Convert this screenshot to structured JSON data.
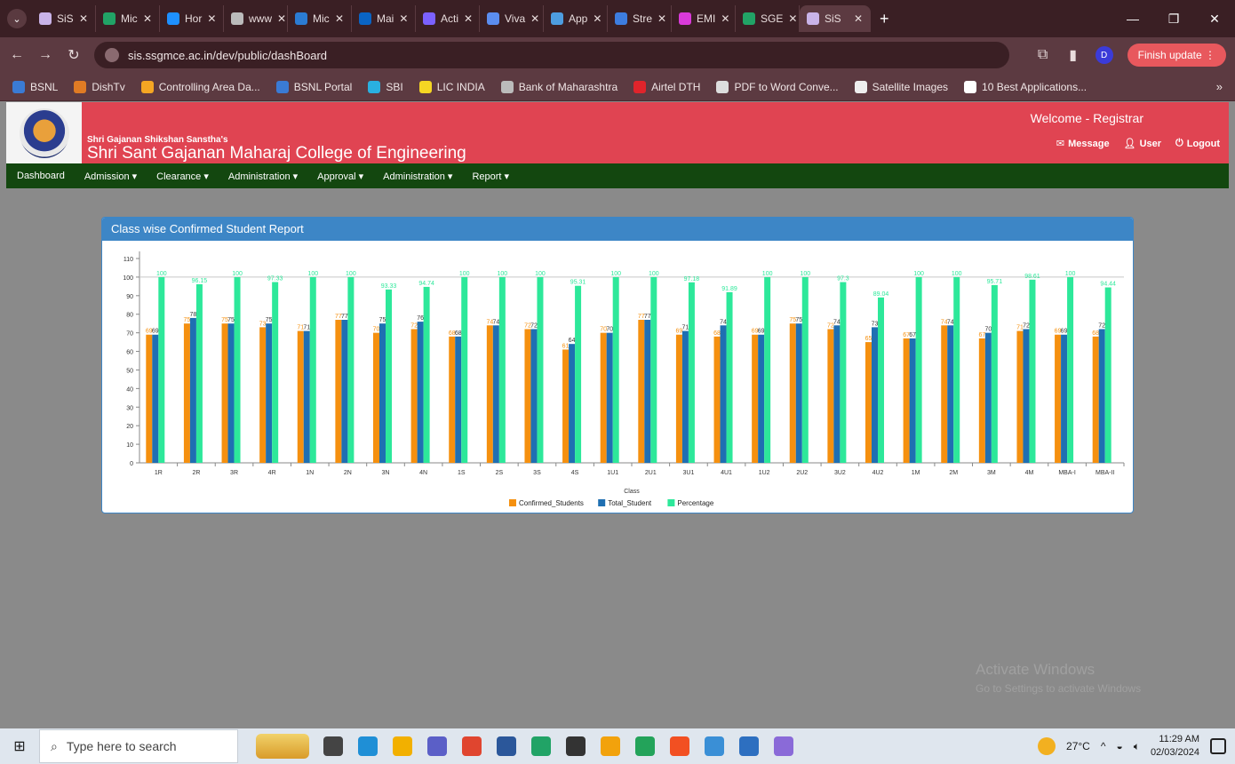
{
  "browser": {
    "tabs": [
      {
        "label": "SiS",
        "color": "#c9b3e8"
      },
      {
        "label": "Mic",
        "color": "#21a366"
      },
      {
        "label": "Hor",
        "color": "#1e90ff"
      },
      {
        "label": "www",
        "color": "#bbbbbb"
      },
      {
        "label": "Mic",
        "color": "#2b7cd3"
      },
      {
        "label": "Mai",
        "color": "#0a64c4"
      },
      {
        "label": "Acti",
        "color": "#7b61ff"
      },
      {
        "label": "Viva",
        "color": "#5b8def"
      },
      {
        "label": "App",
        "color": "#4d9de0"
      },
      {
        "label": "Stre",
        "color": "#3d7de0"
      },
      {
        "label": "EMI",
        "color": "#d93ad9"
      },
      {
        "label": "SGE",
        "color": "#21a366"
      },
      {
        "label": "SiS",
        "color": "#c9b3e8",
        "active": true
      }
    ],
    "url": "sis.ssgmce.ac.in/dev/public/dashBoard",
    "profile_initial": "D",
    "finish_update": "Finish update",
    "bookmarks": [
      {
        "label": "BSNL",
        "color": "#3a7bd5"
      },
      {
        "label": "DishTv",
        "color": "#e07b24"
      },
      {
        "label": "Controlling Area Da...",
        "color": "#f5a623"
      },
      {
        "label": "BSNL Portal",
        "color": "#3a7bd5"
      },
      {
        "label": "SBI",
        "color": "#2ab0e0"
      },
      {
        "label": "LIC INDIA",
        "color": "#f5d623"
      },
      {
        "label": "Bank of Maharashtra",
        "color": "#bbbbbb"
      },
      {
        "label": "Airtel DTH",
        "color": "#e0242b"
      },
      {
        "label": "PDF to Word Conve...",
        "color": "#dddddd"
      },
      {
        "label": "Satellite Images",
        "color": "#eeeeee"
      },
      {
        "label": "10 Best Applications...",
        "color": "#ffffff"
      }
    ]
  },
  "site": {
    "sanstha": "Shri Gajanan Shikshan Sanstha's",
    "college": "Shri Sant Gajanan Maharaj College of Engineering",
    "welcome": "Welcome - Registrar",
    "links": {
      "message": "Message",
      "user": "User",
      "logout": "Logout"
    },
    "nav": [
      "Dashboard",
      "Admission",
      "Clearance",
      "Administration",
      "Approval",
      "Administration",
      "Report"
    ]
  },
  "panel": {
    "title": "Class wise Confirmed Student Report"
  },
  "chart_data": {
    "type": "bar",
    "xlabel": "Class",
    "ylabel": "",
    "ylim": [
      0,
      110
    ],
    "yticks": [
      0,
      10,
      20,
      30,
      40,
      50,
      60,
      70,
      80,
      90,
      100,
      110
    ],
    "legend_position": "bottom",
    "categories": [
      "1R",
      "2R",
      "3R",
      "4R",
      "1N",
      "2N",
      "3N",
      "4N",
      "1S",
      "2S",
      "3S",
      "4S",
      "1U1",
      "2U1",
      "3U1",
      "4U1",
      "1U2",
      "2U2",
      "3U2",
      "4U2",
      "1M",
      "2M",
      "3M",
      "4M",
      "MBA-I",
      "MBA-II"
    ],
    "series": [
      {
        "name": "Confirmed_Students",
        "color": "#f5900f",
        "values": [
          69,
          75,
          75,
          73,
          71,
          77,
          70,
          72,
          68,
          74,
          72,
          61,
          70,
          77,
          69,
          68,
          69,
          75,
          72,
          65,
          67,
          74,
          67,
          71,
          69,
          68
        ]
      },
      {
        "name": "Total_Student",
        "color": "#1f6fb2",
        "values": [
          69,
          78,
          75,
          75,
          71,
          77,
          75,
          76,
          68,
          74,
          72,
          64,
          70,
          77,
          71,
          74,
          69,
          75,
          74,
          73,
          67,
          74,
          70,
          72,
          69,
          72
        ]
      },
      {
        "name": "Percentage",
        "color": "#2de89a",
        "values": [
          100,
          96.15,
          100,
          97.33,
          100,
          100,
          93.33,
          94.74,
          100,
          100,
          100,
          95.31,
          100,
          100,
          97.18,
          91.89,
          100,
          100,
          97.3,
          89.04,
          100,
          100,
          95.71,
          98.61,
          100,
          94.44
        ]
      }
    ]
  },
  "windows": {
    "watermark_title": "Activate Windows",
    "watermark_sub": "Go to Settings to activate Windows",
    "search_placeholder": "Type here to search",
    "weather": "27°C",
    "time": "11:29 AM",
    "date": "02/03/2024",
    "taskbar_apps": [
      "#444444",
      "#1f8fd6",
      "#f2b000",
      "#5b5fc7",
      "#e0452f",
      "#2b579a",
      "#21a366",
      "#333333",
      "#f2a20c",
      "#23a35a",
      "#f25022",
      "#3a8fd6",
      "#2d6fc0",
      "#8a6ad8"
    ]
  }
}
